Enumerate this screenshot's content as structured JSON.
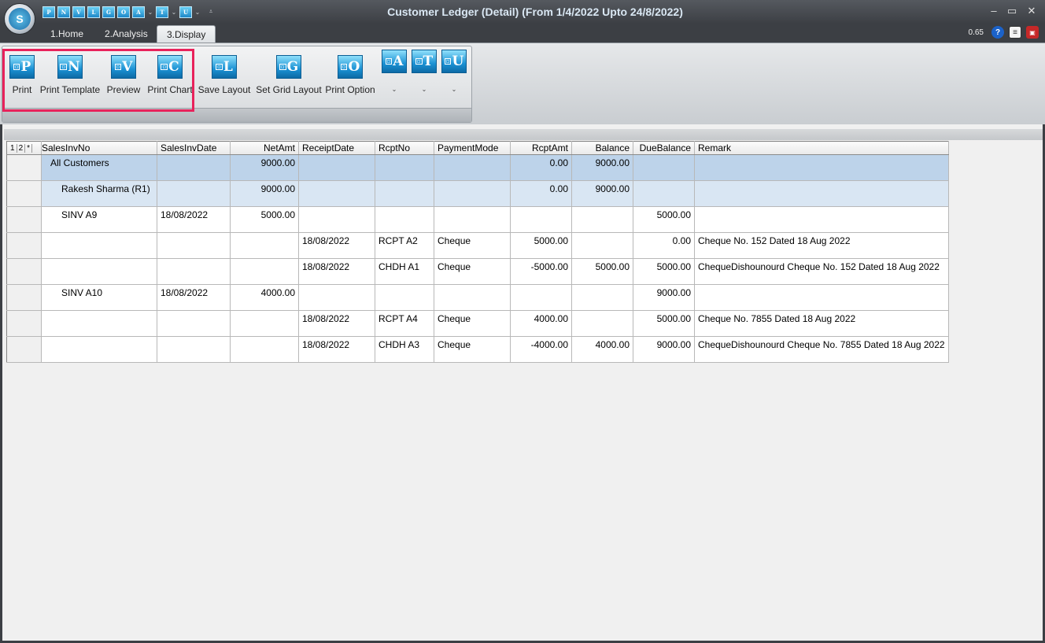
{
  "window": {
    "title": "Customer Ledger (Detail)  (From 1/4/2022 Upto 24/8/2022)",
    "version": "0.65"
  },
  "app_logo": "S",
  "qat": [
    {
      "icon": "P",
      "name": "print"
    },
    {
      "icon": "N",
      "name": "print-template"
    },
    {
      "icon": "V",
      "name": "preview"
    },
    {
      "icon": "L",
      "name": "save-layout"
    },
    {
      "icon": "G",
      "name": "set-grid-layout"
    },
    {
      "icon": "O",
      "name": "print-option"
    },
    {
      "icon": "A",
      "name": "a"
    },
    {
      "icon": "T",
      "name": "t"
    },
    {
      "icon": "U",
      "name": "u"
    }
  ],
  "tabs": [
    "1.Home",
    "2.Analysis",
    "3.Display"
  ],
  "ribbon": {
    "buttons": [
      {
        "icon": "P",
        "label": "Print"
      },
      {
        "icon": "N",
        "label": "Print Template"
      },
      {
        "icon": "V",
        "label": "Preview"
      },
      {
        "icon": "C",
        "label": "Print Chart"
      },
      {
        "icon": "L",
        "label": "Save Layout"
      },
      {
        "icon": "G",
        "label": "Set Grid Layout"
      },
      {
        "icon": "O",
        "label": "Print Option"
      }
    ],
    "dropdowns": [
      {
        "icon": "A"
      },
      {
        "icon": "T"
      },
      {
        "icon": "U"
      }
    ]
  },
  "grid": {
    "level_buttons": [
      "1",
      "2",
      "*"
    ],
    "columns": [
      "SalesInvNo",
      "SalesInvDate",
      "NetAmt",
      "ReceiptDate",
      "RcptNo",
      "PaymentMode",
      "RcptAmt",
      "Balance",
      "DueBalance",
      "Remark"
    ],
    "rows": [
      {
        "level": 0,
        "cells": [
          "All Customers",
          "",
          "9000.00",
          "",
          "",
          "",
          "0.00",
          "9000.00",
          "",
          ""
        ]
      },
      {
        "level": 1,
        "cells": [
          "Rakesh Sharma (R1)",
          "",
          "9000.00",
          "",
          "",
          "",
          "0.00",
          "9000.00",
          "",
          ""
        ]
      },
      {
        "level": 2,
        "cells": [
          "SINV A9",
          "18/08/2022",
          "5000.00",
          "",
          "",
          "",
          "",
          "",
          "5000.00",
          ""
        ]
      },
      {
        "level": 2,
        "cells": [
          "",
          "",
          "",
          "18/08/2022",
          "RCPT A2",
          "Cheque",
          "5000.00",
          "",
          "0.00",
          "Cheque No. 152 Dated 18 Aug 2022"
        ]
      },
      {
        "level": 2,
        "cells": [
          "",
          "",
          "",
          "18/08/2022",
          "CHDH A1",
          "Cheque",
          "-5000.00",
          "5000.00",
          "5000.00",
          "ChequeDishounourd Cheque No. 152 Dated 18 Aug 2022"
        ]
      },
      {
        "level": 2,
        "cells": [
          "SINV A10",
          "18/08/2022",
          "4000.00",
          "",
          "",
          "",
          "",
          "",
          "9000.00",
          ""
        ]
      },
      {
        "level": 2,
        "cells": [
          "",
          "",
          "",
          "18/08/2022",
          "RCPT A4",
          "Cheque",
          "4000.00",
          "",
          "5000.00",
          "Cheque No. 7855 Dated 18 Aug 2022"
        ]
      },
      {
        "level": 2,
        "cells": [
          "",
          "",
          "",
          "18/08/2022",
          "CHDH A3",
          "Cheque",
          "-4000.00",
          "4000.00",
          "9000.00",
          "ChequeDishounourd Cheque No. 7855 Dated 18 Aug 2022"
        ]
      }
    ]
  }
}
